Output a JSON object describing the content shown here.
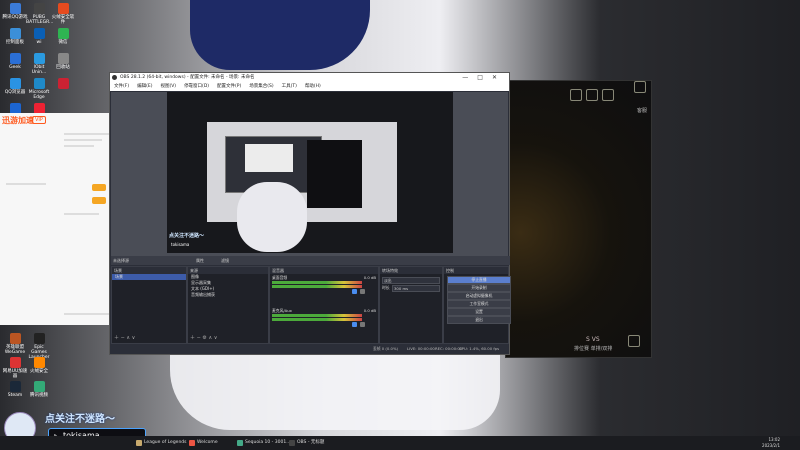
{
  "desktop": {
    "icons": [
      {
        "label": "腾讯QQ游戏",
        "color": "#3b7bd8"
      },
      {
        "label": "PUBG BATTLEGR...",
        "color": "#444"
      },
      {
        "label": "火绒安全软件",
        "color": "#e64b1f"
      },
      {
        "label": "控制面板",
        "color": "#3b8fd8"
      },
      {
        "label": "wi",
        "color": "#0a5fb5"
      },
      {
        "label": "微信",
        "color": "#2fb452"
      },
      {
        "label": "Geek",
        "color": "#2b6fd6"
      },
      {
        "label": "IObit Unin...",
        "color": "#2a9ae0"
      },
      {
        "label": "回收站",
        "color": "#888"
      },
      {
        "label": "QQ浏览器",
        "color": "#2a93e4"
      },
      {
        "label": "Microsoft Edge",
        "color": "#1f8ac9"
      },
      {
        "label": "",
        "color": "#c23"
      },
      {
        "label": "",
        "color": "#1c65d1"
      },
      {
        "label": "",
        "color": "#e23"
      }
    ],
    "lower_icons": [
      {
        "label": "英雄联盟WeGame",
        "color": "#b52"
      },
      {
        "label": "Epic Games Launcher",
        "color": "#222"
      },
      {
        "label": "网易UU加速器",
        "color": "#d33"
      },
      {
        "label": "火绒安全",
        "color": "#f80"
      },
      {
        "label": "Steam",
        "color": "#1b2838"
      },
      {
        "label": "腾讯视频",
        "color": "#3a7"
      }
    ]
  },
  "left_app": {
    "brand": "迅游加速",
    "tag": "VIP"
  },
  "obs": {
    "title": "OBS 28.1.2 (64-bit, windows) - 配置文件: 未命名 - 场景: 未命名",
    "menu": [
      "文件(F)",
      "编辑(E)",
      "视图(V)",
      "停靠窗口(D)",
      "配置文件(P)",
      "场景集合(S)",
      "工具(T)",
      "帮助(H)"
    ],
    "window_controls": [
      "—",
      "□",
      "✕"
    ],
    "preview": {
      "banner": "点关注不迷路～",
      "handle": "tokisama"
    },
    "scene_bar": {
      "left": "未选择源",
      "mid_items": [
        "属性",
        "滤镜"
      ]
    },
    "docks": {
      "scenes": {
        "title": "场景",
        "items": [
          "场景"
        ]
      },
      "sources": {
        "title": "来源",
        "items": [
          "图像",
          "显示器采集",
          "文本 (GDI+)",
          "音频输出捕获"
        ]
      },
      "mixer": {
        "title": "混音器",
        "channels": [
          {
            "name": "桌面音频",
            "db": "0.0 dB"
          },
          {
            "name": "麦克风/Aux",
            "db": "0.0 dB"
          }
        ]
      },
      "transitions": {
        "title": "转场特效",
        "type": "淡出",
        "duration_label": "时长",
        "duration": "300 ms"
      },
      "controls": {
        "title": "控制",
        "buttons": [
          "停止直播",
          "开始录制",
          "启动虚拟摄像机",
          "工作室模式",
          "设置",
          "退出"
        ]
      }
    },
    "status": {
      "dropped": "丢帧 0 (0.0%)",
      "live": "LIVE: 00:00:00",
      "rec": "REC: 00:00:00",
      "cpu": "CPU: 1.4%, 60.00 fps",
      "bitrate": "kb/s: 0"
    }
  },
  "game": {
    "top_label": "客服",
    "level": "S VS",
    "subtitle": "排位赛 单排/双排"
  },
  "overlay": {
    "text": "点关注不迷路～",
    "tiktok": "tokisama"
  },
  "taskbar": {
    "items": [
      {
        "label": "League of Legends",
        "color": "#c8aa6e"
      },
      {
        "label": "Welcome",
        "color": "#e54"
      },
      {
        "label": "Sequoia 10 - 3001...",
        "color": "#4a8"
      },
      {
        "label": "OBS - 无标题",
        "color": "#444"
      }
    ],
    "time": "13:02",
    "date": "2023/2/1"
  }
}
